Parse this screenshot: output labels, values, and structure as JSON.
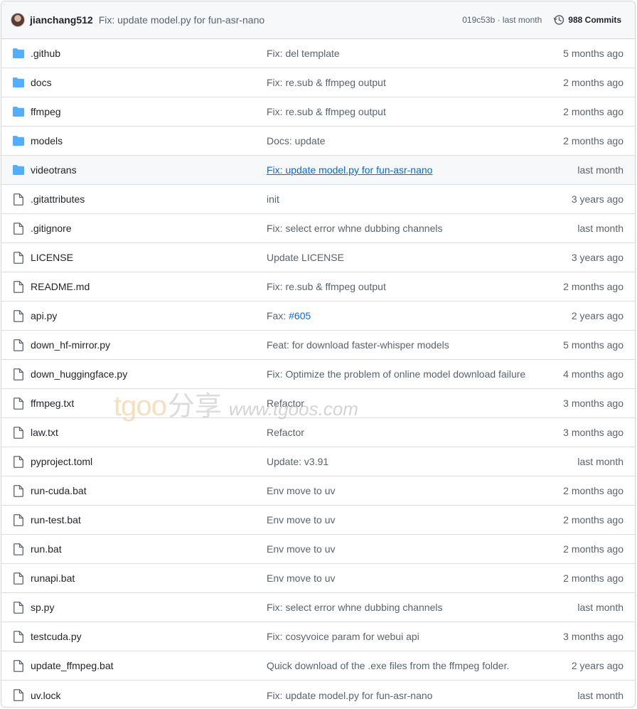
{
  "latest_commit": {
    "author": "jianchang512",
    "message": "Fix: update model.py for fun-asr-nano",
    "sha_time": "019c53b · last month",
    "commits_label": "988 Commits"
  },
  "files": [
    {
      "type": "folder",
      "name": ".github",
      "message": "Fix: del template",
      "time": "5 months ago"
    },
    {
      "type": "folder",
      "name": "docs",
      "message": "Fix: re.sub & ffmpeg output",
      "time": "2 months ago"
    },
    {
      "type": "folder",
      "name": "ffmpeg",
      "message": "Fix: re.sub & ffmpeg output",
      "time": "2 months ago"
    },
    {
      "type": "folder",
      "name": "models",
      "message": "Docs: update",
      "time": "2 months ago"
    },
    {
      "type": "folder",
      "name": "videotrans",
      "message": "Fix: update model.py for fun-asr-nano",
      "time": "last month"
    },
    {
      "type": "file",
      "name": ".gitattributes",
      "message": "init",
      "time": "3 years ago"
    },
    {
      "type": "file",
      "name": ".gitignore",
      "message": "Fix: select error whne dubbing channels",
      "time": "last month"
    },
    {
      "type": "file",
      "name": "LICENSE",
      "message": "Update LICENSE",
      "time": "3 years ago"
    },
    {
      "type": "file",
      "name": "README.md",
      "message": "Fix: re.sub & ffmpeg output",
      "time": "2 months ago"
    },
    {
      "type": "file",
      "name": "api.py",
      "message": "Fax: ",
      "message_link": "#605",
      "time": "2 years ago"
    },
    {
      "type": "file",
      "name": "down_hf-mirror.py",
      "message": "Feat: for download faster-whisper models",
      "time": "5 months ago"
    },
    {
      "type": "file",
      "name": "down_huggingface.py",
      "message": "Fix: Optimize the problem of online model download failure",
      "time": "4 months ago"
    },
    {
      "type": "file",
      "name": "ffmpeg.txt",
      "message": "Refactor",
      "time": "3 months ago"
    },
    {
      "type": "file",
      "name": "law.txt",
      "message": "Refactor",
      "time": "3 months ago"
    },
    {
      "type": "file",
      "name": "pyproject.toml",
      "message": "Update: v3.91",
      "time": "last month"
    },
    {
      "type": "file",
      "name": "run-cuda.bat",
      "message": "Env move to uv",
      "time": "2 months ago"
    },
    {
      "type": "file",
      "name": "run-test.bat",
      "message": "Env move to uv",
      "time": "2 months ago"
    },
    {
      "type": "file",
      "name": "run.bat",
      "message": "Env move to uv",
      "time": "2 months ago"
    },
    {
      "type": "file",
      "name": "runapi.bat",
      "message": "Env move to uv",
      "time": "2 months ago"
    },
    {
      "type": "file",
      "name": "sp.py",
      "message": "Fix: select error whne dubbing channels",
      "time": "last month"
    },
    {
      "type": "file",
      "name": "testcuda.py",
      "message": "Fix: cosyvoice param for webui api",
      "time": "3 months ago"
    },
    {
      "type": "file",
      "name": "update_ffmpeg.bat",
      "message": "Quick download of the .exe files from the ffmpeg folder.",
      "time": "2 years ago"
    },
    {
      "type": "file",
      "name": "uv.lock",
      "message": "Fix: update model.py for fun-asr-nano",
      "time": "last month"
    }
  ],
  "watermark": {
    "brand": "tgoo",
    "cn": "分享",
    "url": "www.tgoos.com"
  },
  "colors": {
    "folder": "#54aeff",
    "link": "#0969da",
    "muted": "#59636e",
    "border": "#d0d7de"
  }
}
